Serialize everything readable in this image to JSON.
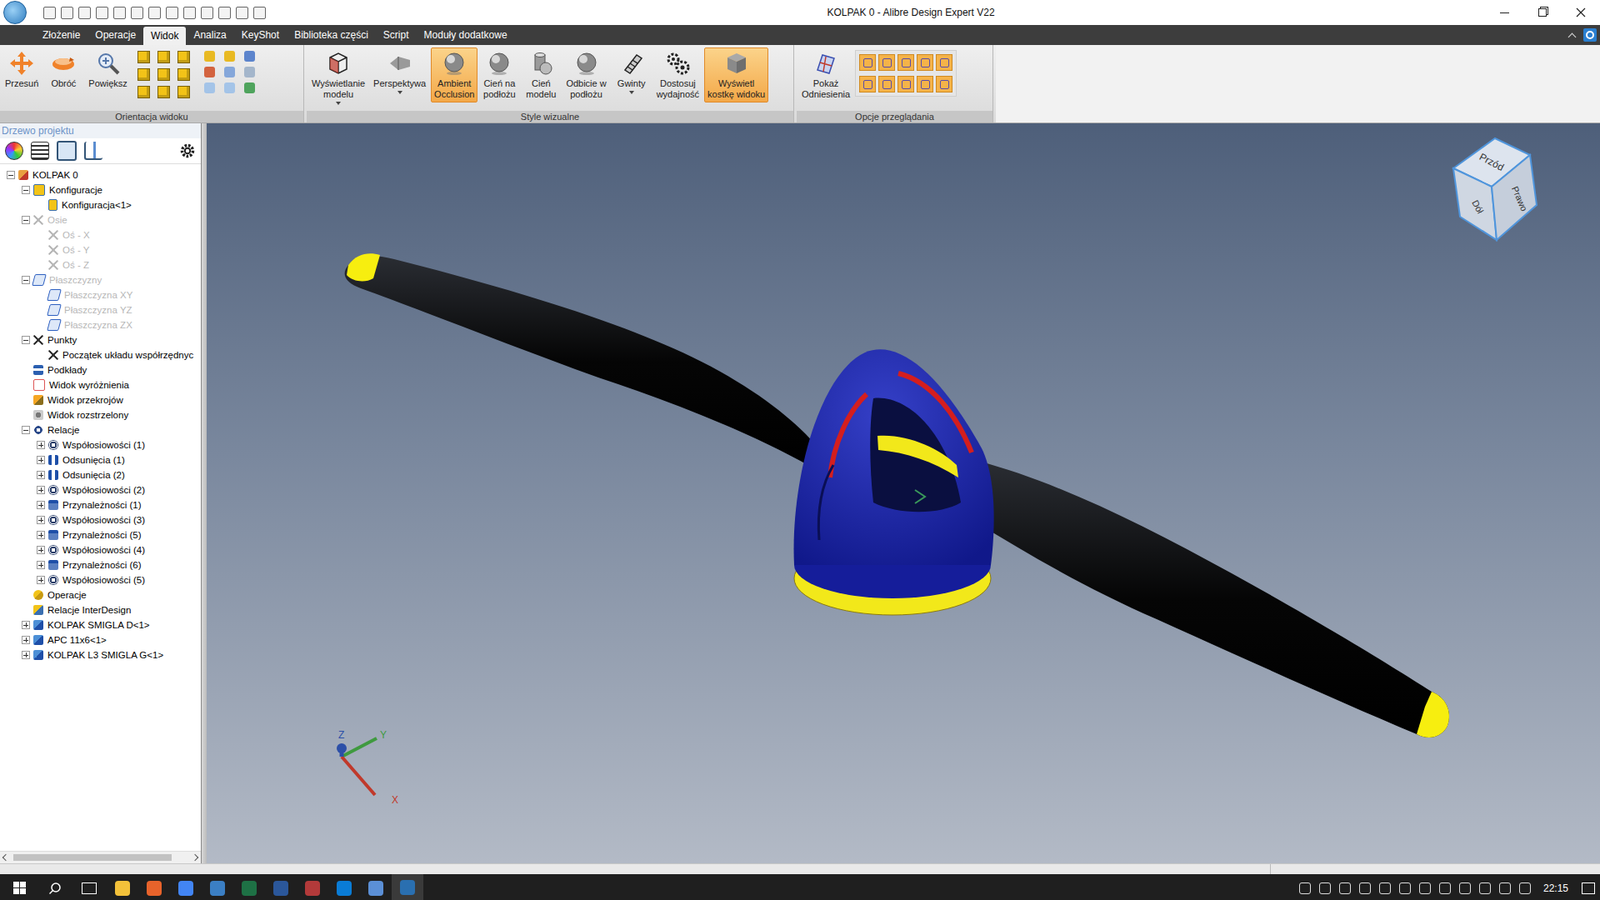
{
  "window": {
    "title": "KOLPAK 0 - Alibre Design Expert V22"
  },
  "tabs": [
    {
      "label": "Złożenie",
      "selected": false
    },
    {
      "label": "Operacje",
      "selected": false
    },
    {
      "label": "Widok",
      "selected": true
    },
    {
      "label": "Analiza",
      "selected": false
    },
    {
      "label": "KeyShot",
      "selected": false
    },
    {
      "label": "Biblioteka części",
      "selected": false
    },
    {
      "label": "Script",
      "selected": false
    },
    {
      "label": "Moduły dodatkowe",
      "selected": false
    }
  ],
  "ribbon": {
    "groups": [
      {
        "label": "Orientacja widoku",
        "buttons": [
          {
            "lines": [
              "Przesuń"
            ],
            "kind": "pan",
            "active": false,
            "dropdown": false
          },
          {
            "lines": [
              "Obróć"
            ],
            "kind": "rotate",
            "active": false,
            "dropdown": false
          },
          {
            "lines": [
              "Powiększ"
            ],
            "kind": "zoom",
            "active": false,
            "dropdown": false
          }
        ]
      },
      {
        "label": "Style wizualne",
        "buttons": [
          {
            "lines": [
              "Wyświetlanie",
              "modelu"
            ],
            "kind": "display",
            "active": false,
            "dropdown": true
          },
          {
            "lines": [
              "Perspektywa"
            ],
            "kind": "perspective",
            "active": false,
            "dropdown": true
          },
          {
            "lines": [
              "Ambient",
              "Occlusion"
            ],
            "kind": "sphere",
            "active": true,
            "dropdown": false
          },
          {
            "lines": [
              "Cień na",
              "podłożu"
            ],
            "kind": "sphere",
            "active": false,
            "dropdown": false
          },
          {
            "lines": [
              "Cień",
              "modelu"
            ],
            "kind": "cylinder",
            "active": false,
            "dropdown": false
          },
          {
            "lines": [
              "Odbicie w",
              "podłożu"
            ],
            "kind": "sphere",
            "active": false,
            "dropdown": false
          },
          {
            "lines": [
              "Gwinty"
            ],
            "kind": "thread",
            "active": false,
            "dropdown": true
          },
          {
            "lines": [
              "Dostosuj",
              "wydajność"
            ],
            "kind": "gears",
            "active": false,
            "dropdown": false
          },
          {
            "lines": [
              "Wyświetl",
              "kostkę widoku"
            ],
            "kind": "cube",
            "active": true,
            "dropdown": false
          }
        ]
      },
      {
        "label": "Opcje przeglądania",
        "buttons": [
          {
            "lines": [
              "Pokaż",
              "Odniesienia"
            ],
            "kind": "reference",
            "active": false,
            "dropdown": false
          }
        ]
      }
    ]
  },
  "project_tree": {
    "title": "Drzewo projektu",
    "items": [
      {
        "label": "KOLPAK 0",
        "depth": 0,
        "kind": "assembly",
        "expandable": true,
        "expanded": true,
        "greyed": false
      },
      {
        "label": "Konfiguracje",
        "depth": 1,
        "kind": "config-folder",
        "expandable": true,
        "expanded": true,
        "greyed": false
      },
      {
        "label": "Konfiguracja<1>",
        "depth": 2,
        "kind": "config",
        "expandable": false,
        "expanded": false,
        "greyed": false
      },
      {
        "label": "Osie",
        "depth": 1,
        "kind": "axis",
        "expandable": true,
        "expanded": true,
        "greyed": true
      },
      {
        "label": "Oś - X",
        "depth": 2,
        "kind": "axis",
        "expandable": false,
        "expanded": false,
        "greyed": true
      },
      {
        "label": "Oś - Y",
        "depth": 2,
        "kind": "axis",
        "expandable": false,
        "expanded": false,
        "greyed": true
      },
      {
        "label": "Oś - Z",
        "depth": 2,
        "kind": "axis",
        "expandable": false,
        "expanded": false,
        "greyed": true
      },
      {
        "label": "Płaszczyzny",
        "depth": 1,
        "kind": "plane",
        "expandable": true,
        "expanded": true,
        "greyed": true
      },
      {
        "label": "Płaszczyzna XY",
        "depth": 2,
        "kind": "plane",
        "expandable": false,
        "expanded": false,
        "greyed": true
      },
      {
        "label": "Płaszczyzna YZ",
        "depth": 2,
        "kind": "plane",
        "expandable": false,
        "expanded": false,
        "greyed": true
      },
      {
        "label": "Płaszczyzna ZX",
        "depth": 2,
        "kind": "plane",
        "expandable": false,
        "expanded": false,
        "greyed": true
      },
      {
        "label": "Punkty",
        "depth": 1,
        "kind": "point",
        "expandable": true,
        "expanded": true,
        "greyed": false
      },
      {
        "label": "Początek układu współrzędnyc",
        "depth": 2,
        "kind": "point",
        "expandable": false,
        "expanded": false,
        "greyed": false
      },
      {
        "label": "Podkłady",
        "depth": 1,
        "kind": "sketch",
        "expandable": false,
        "expanded": false,
        "greyed": false
      },
      {
        "label": "Widok wyróżnienia",
        "depth": 1,
        "kind": "highlight",
        "expandable": false,
        "expanded": false,
        "greyed": false
      },
      {
        "label": "Widok przekrojów",
        "depth": 1,
        "kind": "section",
        "expandable": false,
        "expanded": false,
        "greyed": false
      },
      {
        "label": "Widok rozstrzelony",
        "depth": 1,
        "kind": "exploded",
        "expandable": false,
        "expanded": false,
        "greyed": false
      },
      {
        "label": "Relacje",
        "depth": 1,
        "kind": "relations",
        "expandable": true,
        "expanded": true,
        "greyed": false
      },
      {
        "label": "Współosiowości (1)",
        "depth": 2,
        "kind": "coaxial",
        "expandable": true,
        "expanded": false,
        "greyed": false
      },
      {
        "label": "Odsunięcia (1)",
        "depth": 2,
        "kind": "offset",
        "expandable": true,
        "expanded": false,
        "greyed": false
      },
      {
        "label": "Odsunięcia (2)",
        "depth": 2,
        "kind": "offset",
        "expandable": true,
        "expanded": false,
        "greyed": false
      },
      {
        "label": "Współosiowości (2)",
        "depth": 2,
        "kind": "coaxial",
        "expandable": true,
        "expanded": false,
        "greyed": false
      },
      {
        "label": "Przynależności (1)",
        "depth": 2,
        "kind": "mate",
        "expandable": true,
        "expanded": false,
        "greyed": false
      },
      {
        "label": "Współosiowości (3)",
        "depth": 2,
        "kind": "coaxial",
        "expandable": true,
        "expanded": false,
        "greyed": false
      },
      {
        "label": "Przynależności (5)",
        "depth": 2,
        "kind": "mate",
        "expandable": true,
        "expanded": false,
        "greyed": false
      },
      {
        "label": "Współosiowości (4)",
        "depth": 2,
        "kind": "coaxial",
        "expandable": true,
        "expanded": false,
        "greyed": false
      },
      {
        "label": "Przynależności (6)",
        "depth": 2,
        "kind": "mate",
        "expandable": true,
        "expanded": false,
        "greyed": false
      },
      {
        "label": "Współosiowości (5)",
        "depth": 2,
        "kind": "coaxial",
        "expandable": true,
        "expanded": false,
        "greyed": false
      },
      {
        "label": "Operacje",
        "depth": 1,
        "kind": "features",
        "expandable": false,
        "expanded": false,
        "greyed": false
      },
      {
        "label": "Relacje InterDesign",
        "depth": 1,
        "kind": "interdesign",
        "expandable": false,
        "expanded": false,
        "greyed": false
      },
      {
        "label": "KOLPAK SMIGLA D<1>",
        "depth": 1,
        "kind": "part",
        "expandable": true,
        "expanded": false,
        "greyed": false
      },
      {
        "label": "APC 11x6<1>",
        "depth": 1,
        "kind": "part",
        "expandable": true,
        "expanded": false,
        "greyed": false
      },
      {
        "label": "KOLPAK L3 SMIGLA G<1>",
        "depth": 1,
        "kind": "part",
        "expandable": true,
        "expanded": false,
        "greyed": false
      }
    ]
  },
  "view_cube": {
    "top": "Przód",
    "right": "Prawo",
    "front": "Dół"
  },
  "axes": [
    {
      "label": "Z",
      "color": "#2c4fa8"
    },
    {
      "label": "Y",
      "color": "#3f9a3f"
    },
    {
      "label": "X",
      "color": "#c0392b"
    }
  ],
  "taskbar": {
    "time": "22:15"
  }
}
